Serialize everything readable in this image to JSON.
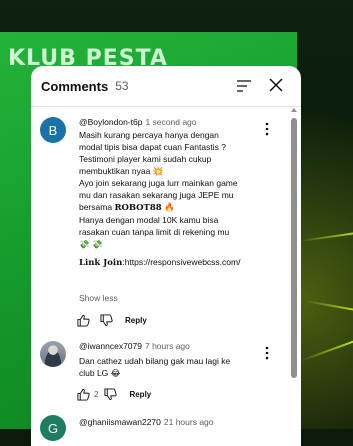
{
  "background": {
    "banner_text": "KLUB PESTA"
  },
  "panel": {
    "title": "Comments",
    "count": "53",
    "icons": {
      "sort": "sort-icon",
      "close": "close-icon",
      "more": "more-vert-icon",
      "like": "thumb-up-icon",
      "dislike": "thumb-down-icon"
    }
  },
  "comments": [
    {
      "avatar_letter": "B",
      "avatar_color": "#1a73a8",
      "author": "@Boylondon-t6p",
      "time": "1 second ago",
      "lines": [
        "Masih kurang percaya hanya dengan",
        "modal tipis bisa dapat cuan Fantastis ?",
        "Testimoni player kami sudah cukup",
        "membuktikan nyaa 💥",
        "Ayo join sekarang juga lurr mainkan game",
        "mu dan rasakan sekarang juga JEPE mu",
        "Hanya dengan modal 10K kamu bisa",
        "rasakan cuan tanpa limit di rekening mu",
        "💸 💸"
      ],
      "line_bersama_prefix": "bersama ",
      "line_bersama_bold": "𝐑𝐎𝐁𝐎𝐓𝟖𝟖",
      "line_bersama_suffix": " 🔥",
      "link_label": "𝐋𝐢𝐧𝐤 𝐉𝐨𝐢𝐧",
      "link_url": ":https://responsivewebcss.com/",
      "show_less": "Show less",
      "likes": "",
      "reply": "Reply"
    },
    {
      "author": "@iwanncex7079",
      "time": "7 hours ago",
      "lines": [
        "Dan cathez udah bilang gak mau lagi ke",
        "club LG 😂"
      ],
      "likes": "2",
      "reply": "Reply"
    },
    {
      "avatar_letter": "G",
      "avatar_color": "#1e7c5f",
      "author": "@ghaniismawan2270",
      "time": "21 hours ago"
    }
  ]
}
